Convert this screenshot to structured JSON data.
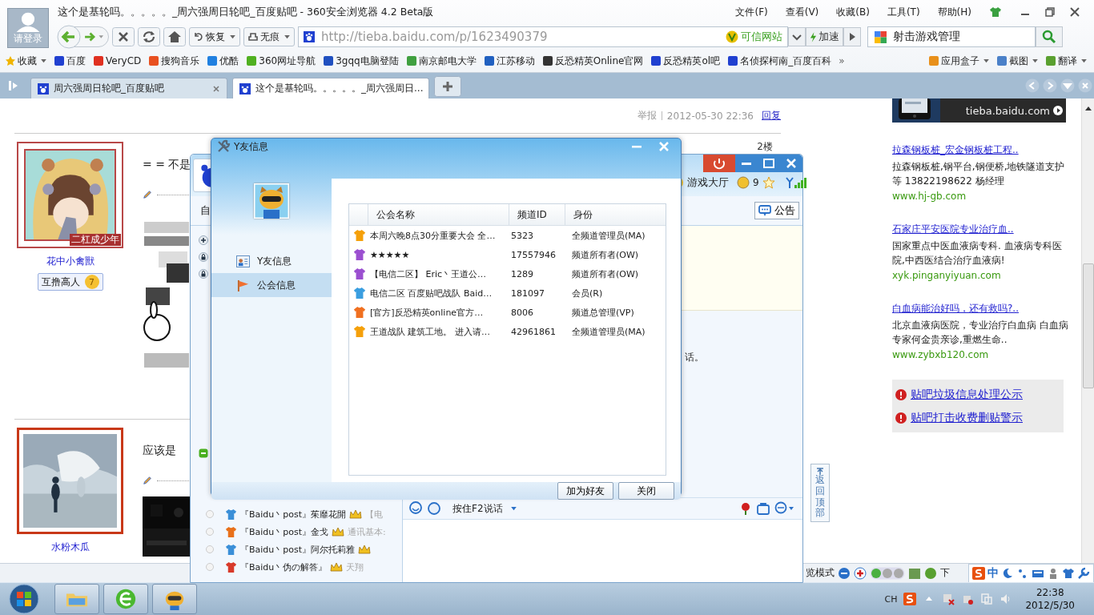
{
  "browser": {
    "title": "这个是基轮吗。。。。。_周六强周日轮吧_百度贴吧 - 360安全浏览器 4.2 Beta版",
    "login_label": "请登录",
    "menus": [
      "文件(F)",
      "查看(V)",
      "收藏(B)",
      "工具(T)",
      "帮助(H)"
    ],
    "nav_buttons": [
      "恢复",
      "无痕"
    ],
    "address": "http://tieba.baidu.com/p/1623490379",
    "trusted_label": "可信网站",
    "speed_label": "加速",
    "search_value": "射击游戏管理"
  },
  "bookmarks": [
    "收藏",
    "百度",
    "VeryCD",
    "搜狗音乐",
    "优酷",
    "360网址导航",
    "3gqq电脑登陆",
    "南京邮电大学",
    "江苏移动",
    "反恐精英Online官网",
    "反恐精英ol吧",
    "名侦探柯南_百度百科"
  ],
  "bookmarks_more": "»",
  "bookmarks_right": [
    "应用盒子",
    "截图",
    "翻译"
  ],
  "tabs": [
    {
      "label": "周六强周日轮吧_百度贴吧",
      "selected": false
    },
    {
      "label": "这个是基轮吗。。。。。_周六强周日...",
      "selected": true
    }
  ],
  "post_header": {
    "report": "举报",
    "date": "2012-05-30 22:36",
    "reply": "回复"
  },
  "posts": [
    {
      "user": "花中小禽獸",
      "avatar_caption": "二杠成少年",
      "badge": "互撸高人",
      "badge_level": "7",
      "text": "= = 不是",
      "floor": "2楼"
    },
    {
      "user": "水粉木瓜",
      "text": "应该是"
    }
  ],
  "ads": {
    "banner_text": "tieba.baidu.com",
    "items": [
      {
        "title": "拉森钢板桩_宏金钢板桩工程..",
        "desc": "拉森钢板桩,钢平台,钢便桥,地铁隧道支护等 13822198622 杨经理",
        "url": "www.hj-gb.com"
      },
      {
        "title": "石家庄平安医院专业治疗血..",
        "desc": "国家重点中医血液病专科. 血液病专科医院,中西医结合治疗血液病!",
        "url": "xyk.pinganyiyuan.com"
      },
      {
        "title": "白血病能治好吗，还有救吗?..",
        "desc": "北京血液病医院，专业治疗白血病 白血病专家何金贵亲诊,重燃生命..",
        "url": "www.zybxb120.com"
      }
    ]
  },
  "notices": [
    "贴吧垃圾信息处理公示",
    "贴吧打击收费删贴警示"
  ],
  "back_to_top": "返回顶部",
  "yy": {
    "hall": "游戏大厅",
    "coins": "9",
    "announcement": "公告",
    "tab_fragment": "自",
    "chat_fragment": "话。",
    "talk_label": "按住F2说话",
    "members": [
      {
        "name": "『Baidu丶post』茱靡花開",
        "note": "【电",
        "color": "#3a8fd8"
      },
      {
        "name": "『Baidu丶post』金戈",
        "note": "通讯基本:",
        "color": "#e8701a"
      },
      {
        "name": "『Baidu丶post』阿尔托莉雅",
        "color": "#3a8fd8"
      },
      {
        "name": "『Baidu丶伪の解答』",
        "note": "天翔",
        "color": "#d83a2a"
      }
    ]
  },
  "dialog": {
    "title": "Y友信息",
    "nav": [
      {
        "label": "Y友信息",
        "selected": false
      },
      {
        "label": "公会信息",
        "selected": true
      }
    ],
    "columns": [
      "公会名称",
      "频道ID",
      "身份"
    ],
    "guilds": [
      {
        "name": "本周六晚8点30分重要大会 全…",
        "channel_id": "5323",
        "role": "全频道管理员(MA)",
        "color": "#f5a00a"
      },
      {
        "name": "★★★★★",
        "channel_id": "17557946",
        "role": "频道所有者(OW)",
        "color": "#9b4fd0"
      },
      {
        "name": "【电信二区】 Eric丶王道公…",
        "channel_id": "1289",
        "role": "频道所有者(OW)",
        "color": "#9b4fd0"
      },
      {
        "name": "电信二区 百度贴吧战队 Baid…",
        "channel_id": "181097",
        "role": "会员(R)",
        "color": "#3a9ee0"
      },
      {
        "name": "[官方]反恐精英online官方…",
        "channel_id": "8006",
        "role": "频道总管理(VP)",
        "color": "#f07020"
      },
      {
        "name": "王道战队 建筑工地。 进入请…",
        "channel_id": "42961861",
        "role": "全频道管理员(MA)",
        "color": "#f5a00a"
      }
    ],
    "buttons": [
      "加为好友",
      "关闭"
    ]
  },
  "status_bar": {
    "mode_fragment": "览模式",
    "download_fragment": "下"
  },
  "ime": {
    "mode": "中"
  },
  "taskbar": {
    "lang": "CH",
    "time": "22:38",
    "date": "2012/5/30"
  }
}
